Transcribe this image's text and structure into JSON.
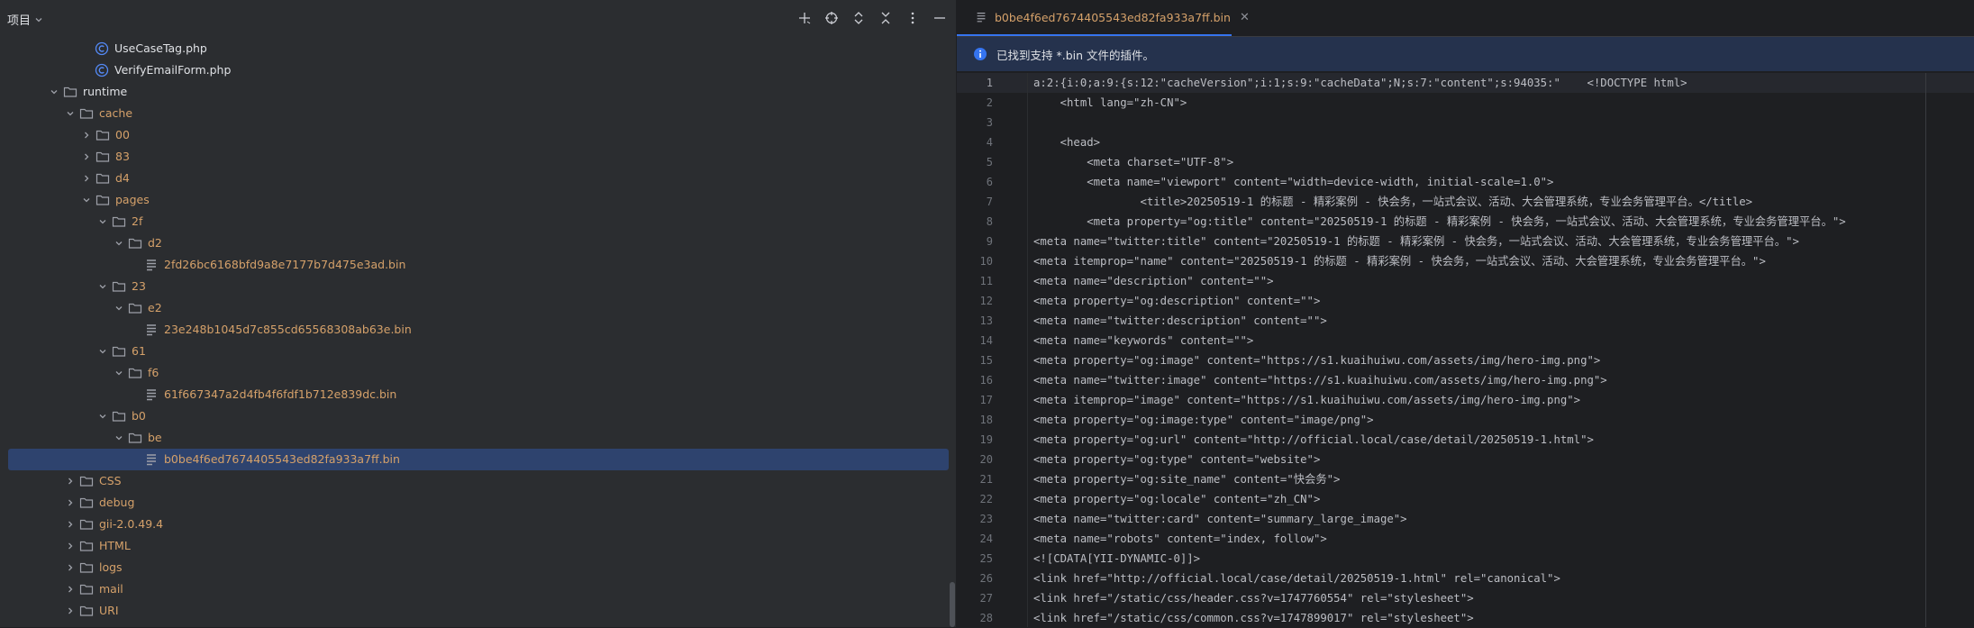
{
  "project": {
    "title": "项目",
    "tree": [
      {
        "indent": 105,
        "expand": "none",
        "icon": "php-class",
        "label": "UseCaseTag.php",
        "style": "cls"
      },
      {
        "indent": 105,
        "expand": "none",
        "icon": "php-class",
        "label": "VerifyEmailForm.php",
        "style": "cls"
      },
      {
        "indent": 70,
        "expand": "open",
        "icon": "folder",
        "label": "runtime",
        "style": "plain"
      },
      {
        "indent": 88,
        "expand": "open",
        "icon": "folder",
        "label": "cache",
        "style": "orange"
      },
      {
        "indent": 106,
        "expand": "closed",
        "icon": "folder",
        "label": "00",
        "style": "orange"
      },
      {
        "indent": 106,
        "expand": "closed",
        "icon": "folder",
        "label": "83",
        "style": "orange"
      },
      {
        "indent": 106,
        "expand": "closed",
        "icon": "folder",
        "label": "d4",
        "style": "orange"
      },
      {
        "indent": 106,
        "expand": "open",
        "icon": "folder",
        "label": "pages",
        "style": "orange"
      },
      {
        "indent": 124,
        "expand": "open",
        "icon": "folder",
        "label": "2f",
        "style": "orange"
      },
      {
        "indent": 142,
        "expand": "open",
        "icon": "folder",
        "label": "d2",
        "style": "orange"
      },
      {
        "indent": 160,
        "expand": "none",
        "icon": "text-file",
        "label": "2fd26bc6168bfd9a8e7177b7d475e3ad.bin",
        "style": "orange"
      },
      {
        "indent": 124,
        "expand": "open",
        "icon": "folder",
        "label": "23",
        "style": "orange"
      },
      {
        "indent": 142,
        "expand": "open",
        "icon": "folder",
        "label": "e2",
        "style": "orange"
      },
      {
        "indent": 160,
        "expand": "none",
        "icon": "text-file",
        "label": "23e248b1045d7c855cd65568308ab63e.bin",
        "style": "orange"
      },
      {
        "indent": 124,
        "expand": "open",
        "icon": "folder",
        "label": "61",
        "style": "orange"
      },
      {
        "indent": 142,
        "expand": "open",
        "icon": "folder",
        "label": "f6",
        "style": "orange"
      },
      {
        "indent": 160,
        "expand": "none",
        "icon": "text-file",
        "label": "61f667347a2d4fb4f6fdf1b712e839dc.bin",
        "style": "orange"
      },
      {
        "indent": 124,
        "expand": "open",
        "icon": "folder",
        "label": "b0",
        "style": "orange"
      },
      {
        "indent": 142,
        "expand": "open",
        "icon": "folder",
        "label": "be",
        "style": "orange"
      },
      {
        "indent": 160,
        "expand": "none",
        "icon": "text-file",
        "label": "b0be4f6ed7674405543ed82fa933a7ff.bin",
        "style": "orange",
        "selected": true
      },
      {
        "indent": 88,
        "expand": "closed",
        "icon": "folder",
        "label": "CSS",
        "style": "orange"
      },
      {
        "indent": 88,
        "expand": "closed",
        "icon": "folder",
        "label": "debug",
        "style": "orange"
      },
      {
        "indent": 88,
        "expand": "closed",
        "icon": "folder",
        "label": "gii-2.0.49.4",
        "style": "orange"
      },
      {
        "indent": 88,
        "expand": "closed",
        "icon": "folder",
        "label": "HTML",
        "style": "orange"
      },
      {
        "indent": 88,
        "expand": "closed",
        "icon": "folder",
        "label": "logs",
        "style": "orange"
      },
      {
        "indent": 88,
        "expand": "closed",
        "icon": "folder",
        "label": "mail",
        "style": "orange"
      },
      {
        "indent": 88,
        "expand": "closed",
        "icon": "folder",
        "label": "URI",
        "style": "orange"
      }
    ]
  },
  "editor": {
    "tab_label": "b0be4f6ed7674405543ed82fa933a7ff.bin",
    "banner_text": "已找到支持 *.bin 文件的插件。",
    "lines": [
      "a:2:{i:0;a:9:{s:12:\"cacheVersion\";i:1;s:9:\"cacheData\";N;s:7:\"content\";s:94035:\"    <!DOCTYPE html>",
      "    <html lang=\"zh-CN\">",
      "",
      "    <head>",
      "        <meta charset=\"UTF-8\">",
      "        <meta name=\"viewport\" content=\"width=device-width, initial-scale=1.0\">",
      "                <title>20250519-1 的标题 - 精彩案例 - 快会务，一站式会议、活动、大会管理系统，专业会务管理平台。</title>",
      "        <meta property=\"og:title\" content=\"20250519-1 的标题 - 精彩案例 - 快会务，一站式会议、活动、大会管理系统，专业会务管理平台。\">",
      "<meta name=\"twitter:title\" content=\"20250519-1 的标题 - 精彩案例 - 快会务，一站式会议、活动、大会管理系统，专业会务管理平台。\">",
      "<meta itemprop=\"name\" content=\"20250519-1 的标题 - 精彩案例 - 快会务，一站式会议、活动、大会管理系统，专业会务管理平台。\">",
      "<meta name=\"description\" content=\"\">",
      "<meta property=\"og:description\" content=\"\">",
      "<meta name=\"twitter:description\" content=\"\">",
      "<meta name=\"keywords\" content=\"\">",
      "<meta property=\"og:image\" content=\"https://s1.kuaihuiwu.com/assets/img/hero-img.png\">",
      "<meta name=\"twitter:image\" content=\"https://s1.kuaihuiwu.com/assets/img/hero-img.png\">",
      "<meta itemprop=\"image\" content=\"https://s1.kuaihuiwu.com/assets/img/hero-img.png\">",
      "<meta property=\"og:image:type\" content=\"image/png\">",
      "<meta property=\"og:url\" content=\"http://official.local/case/detail/20250519-1.html\">",
      "<meta property=\"og:type\" content=\"website\">",
      "<meta property=\"og:site_name\" content=\"快会务\">",
      "<meta property=\"og:locale\" content=\"zh_CN\">",
      "<meta name=\"twitter:card\" content=\"summary_large_image\">",
      "<meta name=\"robots\" content=\"index, follow\">",
      "<![CDATA[YII-DYNAMIC-0]]>",
      "<link href=\"http://official.local/case/detail/20250519-1.html\" rel=\"canonical\">",
      "<link href=\"/static/css/header.css?v=1747760554\" rel=\"stylesheet\">",
      "<link href=\"/static/css/common.css?v=1747899017\" rel=\"stylesheet\">"
    ]
  }
}
